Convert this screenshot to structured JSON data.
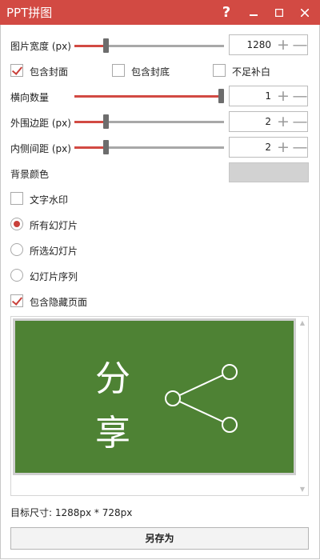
{
  "window": {
    "title": "PPT拼图",
    "help_label": "?",
    "minimize_label": "–",
    "maximize_label": "☐",
    "close_label": "✕",
    "accent_color": "#d24a43"
  },
  "settings": {
    "image_width": {
      "label": "图片宽度 (px)",
      "value": "1280",
      "slider_level_fraction": 0.22
    },
    "include_cover": {
      "label": "包含封面",
      "checked": true
    },
    "include_back_cover": {
      "label": "包含封底",
      "checked": false
    },
    "fill_blank": {
      "label": "不足补白",
      "checked": false
    },
    "horizontal_count": {
      "label": "横向数量",
      "value": "1",
      "slider_level_fraction": 1.0
    },
    "outer_margin": {
      "label": "外围边距 (px)",
      "value": "2",
      "slider_level_fraction": 0.22
    },
    "inner_spacing": {
      "label": "内侧间距 (px)",
      "value": "2",
      "slider_level_fraction": 0.22
    },
    "background_color": {
      "label": "背景颜色",
      "color": "#d2d2d2"
    },
    "text_watermark": {
      "label": "文字水印",
      "checked": false
    },
    "slide_selection": {
      "options": [
        {
          "label": "所有幻灯片",
          "checked": true
        },
        {
          "label": "所选幻灯片",
          "checked": false
        },
        {
          "label": "幻灯片序列",
          "checked": false
        }
      ]
    },
    "include_hidden": {
      "label": "包含隐藏页面",
      "checked": true
    },
    "plus_label": "+",
    "minus_label": "—"
  },
  "preview": {
    "slide_text_line1": "分",
    "slide_text_line2": "享",
    "slide_bg_color": "#4e8234",
    "share_icon": "share-icon"
  },
  "footer": {
    "target_size": "目标尺寸: 1288px * 728px",
    "save_as_label": "另存为"
  }
}
